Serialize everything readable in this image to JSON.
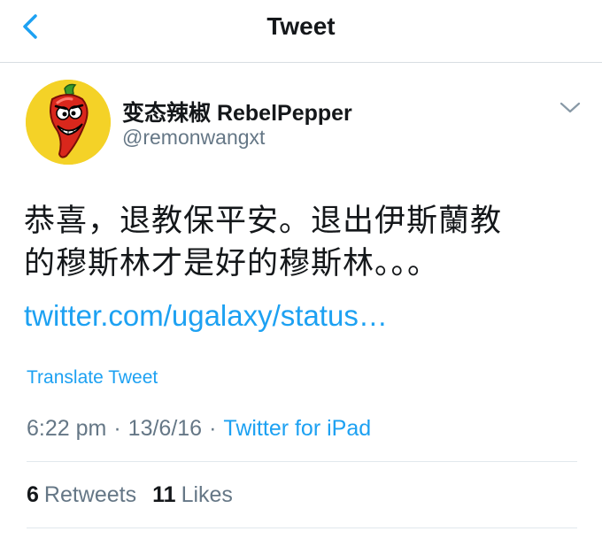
{
  "header": {
    "title": "Tweet",
    "back_icon": "chevron-left-icon"
  },
  "colors": {
    "accent": "#1da1f2",
    "muted": "#657786",
    "text": "#14171a"
  },
  "tweet": {
    "display_name": "变态辣椒 RebelPepper",
    "handle": "@remonwangxt",
    "text_lines": [
      "恭喜，退教保平安。退出伊斯蘭教",
      "的穆斯林才是好的穆斯林。。。"
    ],
    "link": "twitter.com/ugalaxy/status…",
    "translate_label": "Translate Tweet",
    "time": "6:22 pm",
    "date": "13/6/16",
    "source": "Twitter for iPad",
    "retweets_count": "6",
    "retweets_label": "Retweets",
    "likes_count": "11",
    "likes_label": "Likes"
  }
}
